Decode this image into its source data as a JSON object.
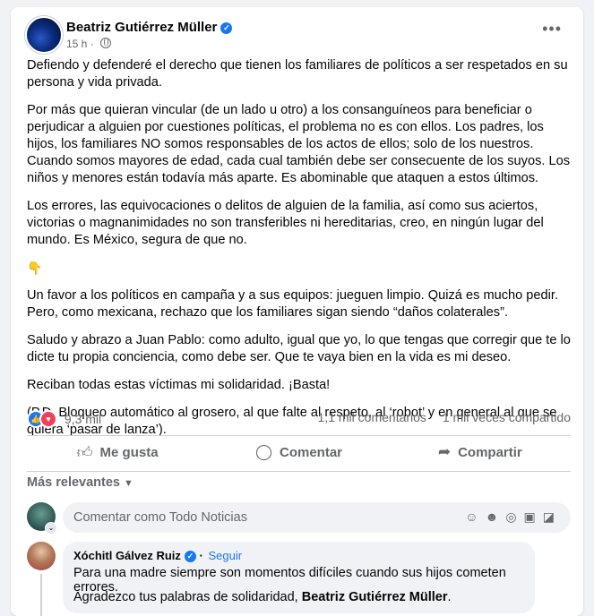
{
  "post": {
    "author": "Beatriz Gutiérrez Müller",
    "time": "15 h",
    "paragraphs": [
      "Defiendo y defenderé el derecho que tienen los familiares de políticos a ser respetados en su persona y vida privada.",
      "Por más que quieran vincular (de un lado u otro) a los  consanguíneos para beneficiar o perjudicar a alguien por cuestiones políticas, el problema no es con ellos. Los padres, los hijos, los familiares NO somos responsables de los actos de ellos; solo de los nuestros. Cuando somos mayores de edad, cada cual también debe ser consecuente de los suyos. Los niños y menores están todavía más aparte. Es abominable que ataquen a estos últimos.",
      "Los errores, las equivocaciones o delitos de alguien de la familia, así como sus aciertos, victorias o magnanimidades no son transferibles ni hereditarias, creo, en ningún lugar del mundo. Es México, segura de que no.",
      "👇",
      "Un favor a los políticos en campaña y a sus equipos: jueguen limpio. Quizá es mucho pedir. Pero, como mexicana, rechazo que los familiares sigan siendo  “daños colaterales”.",
      "Saludo y abrazo a Juan Pablo: como adulto, igual que yo, lo que tengas que corregir que te lo dicte tu propia conciencia, como debe ser. Que te vaya bien en la vida es mi deseo.",
      "Reciban todas estas víctimas mi solidaridad. ¡Basta!",
      "(P.D. Bloqueo automático al grosero, al que falte al respeto, al ‘robot’ y en general al que se quiera ‘pasar de lanza’)."
    ]
  },
  "stats": {
    "reactions": "9,3 mil",
    "comments": "1,1 mil comentarios",
    "shares": "1 mil veces compartido"
  },
  "actions": {
    "like": "Me gusta",
    "comment": "Comentar",
    "share": "Compartir"
  },
  "sort_label": "Más relevantes",
  "composer": {
    "placeholder": "Comentar como Todo Noticias"
  },
  "comment": {
    "author": "Xóchitl Gálvez Ruiz",
    "follow": "Seguir",
    "line1": "Para una madre siempre son momentos difíciles cuando sus hijos cometen errores.",
    "line2_prefix": "Agradezco tus palabras de solidaridad, ",
    "line2_name": "Beatriz Gutiérrez Müller",
    "line2_suffix": "."
  },
  "colors": {
    "accent": "#1877f2",
    "love": "#f33e58",
    "muted": "#65676b"
  }
}
